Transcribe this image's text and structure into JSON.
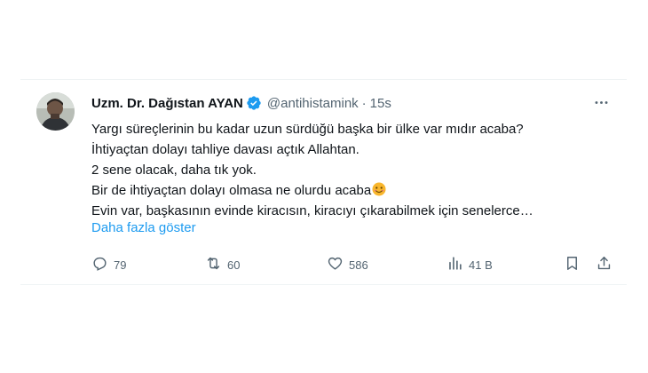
{
  "tweet": {
    "author_name": "Uzm. Dr. Dağıstan AYAN",
    "handle": "@antihistamink",
    "separator": "·",
    "time": "15s",
    "lines": [
      "Yargı süreçlerinin bu kadar uzun sürdüğü başka bir ülke var mıdır acaba?",
      "İhtiyaçtan dolayı tahliye davası açtık Allahtan.",
      "2 sene olacak, daha tık yok.",
      "Bir de ihtiyaçtan dolayı olmasa ne olurdu acaba",
      "Evin var, başkasının evinde kiracısın, kiracıyı çıkarabilmek için senelerce…"
    ],
    "show_more": "Daha fazla göster",
    "actions": {
      "replies": "79",
      "reposts": "60",
      "likes": "586",
      "views": "41 B"
    }
  },
  "icons": {
    "verified": "verified-badge-icon",
    "more": "more-dots-icon",
    "reply": "reply-bubble-icon",
    "repost": "repost-icon",
    "like": "heart-icon",
    "views": "views-bars-icon",
    "bookmark": "bookmark-icon",
    "share": "share-icon",
    "emoji": "smiling-face-emoji"
  },
  "colors": {
    "accent": "#1d9bf0",
    "muted": "#536471",
    "text": "#0f1419",
    "emoji": "#f8b62d"
  }
}
